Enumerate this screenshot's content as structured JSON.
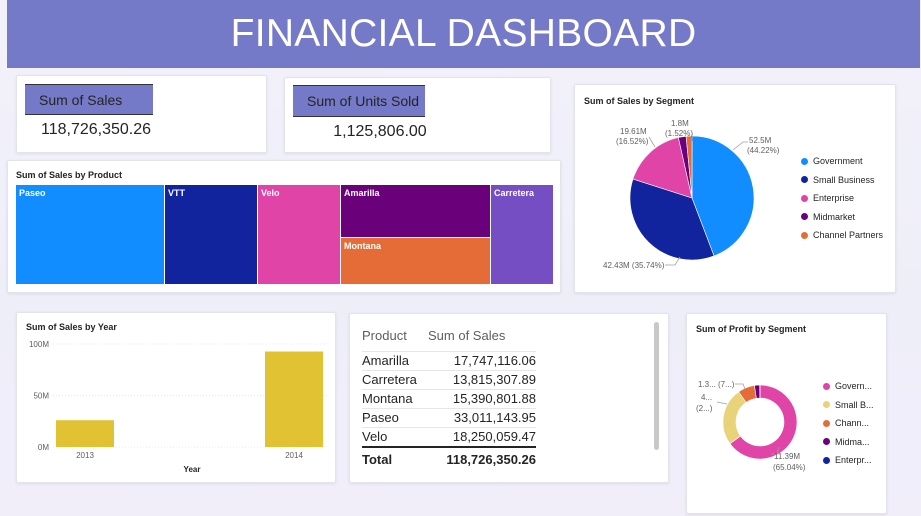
{
  "dashboard": {
    "title": "FINANCIAL DASHBOARD"
  },
  "kpis": {
    "sales": {
      "label": "Sum of Sales",
      "value": "118,726,350.26"
    },
    "units": {
      "label": "Sum of Units Sold",
      "value": "1,125,806.00"
    }
  },
  "colors": {
    "banner": "#7479c8",
    "government": "#118dff",
    "small_business": "#12239e",
    "enterprise": "#e044a7",
    "midmarket": "#6b007b",
    "channel_partners": "#e66c37",
    "year_bars": "#e0c232",
    "profit_government": "#e044a7",
    "profit_small_business": "#e8d27a",
    "profit_channel": "#e66c37",
    "profit_midmarket": "#6b007b",
    "profit_enterprise": "#12239e"
  },
  "product_treemap": {
    "title": "Sum of Sales by Product",
    "tiles": [
      {
        "label": "Paseo",
        "color": "#118dff"
      },
      {
        "label": "VTT",
        "color": "#12239e"
      },
      {
        "label": "Velo",
        "color": "#e044a7"
      },
      {
        "label": "Amarilla",
        "color": "#6b007b"
      },
      {
        "label": "Montana",
        "color": "#e66c37"
      },
      {
        "label": "Carretera",
        "color": "#744ec2"
      }
    ]
  },
  "segment_pie": {
    "title": "Sum of Sales by Segment",
    "legend": [
      "Government",
      "Small Business",
      "Enterprise",
      "Midmarket",
      "Channel Partners"
    ],
    "labels": {
      "government_value": "52.5M",
      "government_pct": "(44.22%)",
      "small_business": "42.43M (35.74%)",
      "enterprise_value": "19.61M",
      "enterprise_pct": "(16.52%)",
      "channel_value": "1.8M",
      "channel_pct": "(1.52%)"
    }
  },
  "table": {
    "headers": [
      "Product",
      "Sum of Sales"
    ],
    "rows": [
      {
        "product": "Amarilla",
        "sales": "17,747,116.06"
      },
      {
        "product": "Carretera",
        "sales": "13,815,307.89"
      },
      {
        "product": "Montana",
        "sales": "15,390,801.88"
      },
      {
        "product": "Paseo",
        "sales": "33,011,143.95"
      },
      {
        "product": "Velo",
        "sales": "18,250,059.47"
      }
    ],
    "total_label": "Total",
    "total_value": "118,726,350.26"
  },
  "profit_donut": {
    "title": "Sum of Profit by Segment",
    "legend": [
      "Govern...",
      "Small B...",
      "Chann...",
      "Midma...",
      "Enterpr..."
    ],
    "labels": {
      "top_left": "1.3... (7...)",
      "left_a": "4...",
      "left_b": "(2...)",
      "bottom_right_a": "11.39M",
      "bottom_right_b": "(65.04%)"
    }
  },
  "chart_data": [
    {
      "type": "bar",
      "title": "Sum of Sales by Year",
      "xlabel": "Year",
      "ylabel": "",
      "categories": [
        "2013",
        "2014"
      ],
      "values": [
        26.0,
        92.7
      ],
      "ylim": [
        0,
        100
      ],
      "yticks": [
        "0M",
        "50M",
        "100M"
      ],
      "grid": true
    },
    {
      "type": "pie",
      "title": "Sum of Sales by Segment",
      "categories": [
        "Government",
        "Small Business",
        "Enterprise",
        "Midmarket",
        "Channel Partners"
      ],
      "values": [
        52.5,
        42.43,
        19.61,
        2.39,
        1.8
      ],
      "percents": [
        44.22,
        35.74,
        16.52,
        2.0,
        1.52
      ]
    },
    {
      "type": "pie",
      "title": "Sum of Profit by Segment",
      "categories": [
        "Govern...",
        "Small B...",
        "Chann...",
        "Midma...",
        "Enterpr..."
      ],
      "values": [
        11.39,
        4.4,
        1.3,
        0.4,
        0.02
      ],
      "percents": [
        65.04,
        25.0,
        7.4,
        2.4,
        0.16
      ]
    },
    {
      "type": "heatmap",
      "title": "Sum of Sales by Product",
      "categories": [
        "Paseo",
        "VTT",
        "Velo",
        "Amarilla",
        "Montana",
        "Carretera"
      ],
      "values": [
        33.01,
        20.51,
        18.25,
        17.75,
        15.39,
        13.82
      ]
    }
  ]
}
